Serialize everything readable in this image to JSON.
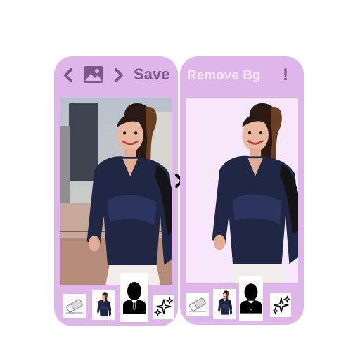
{
  "left_panel": {
    "toolbar": {
      "back_icon": "chevron-left-icon",
      "gallery_icon": "image-icon",
      "forward_icon": "chevron-right-icon",
      "save_label": "Save"
    },
    "tools": [
      "eraser-icon",
      "person-thumbnail",
      "person-silhouette-icon",
      "sparkle-icon"
    ]
  },
  "right_panel": {
    "toolbar": {
      "title": "Remove Bg",
      "alert_label": "!"
    },
    "tools": [
      "eraser-icon",
      "person-thumbnail",
      "person-silhouette-icon",
      "sparkle-icon"
    ]
  },
  "colors": {
    "panel": "#dfb6ea",
    "icon": "#7c5889",
    "title_text": "#f7e9fb",
    "canvas_bg": "#f6e8fa"
  }
}
